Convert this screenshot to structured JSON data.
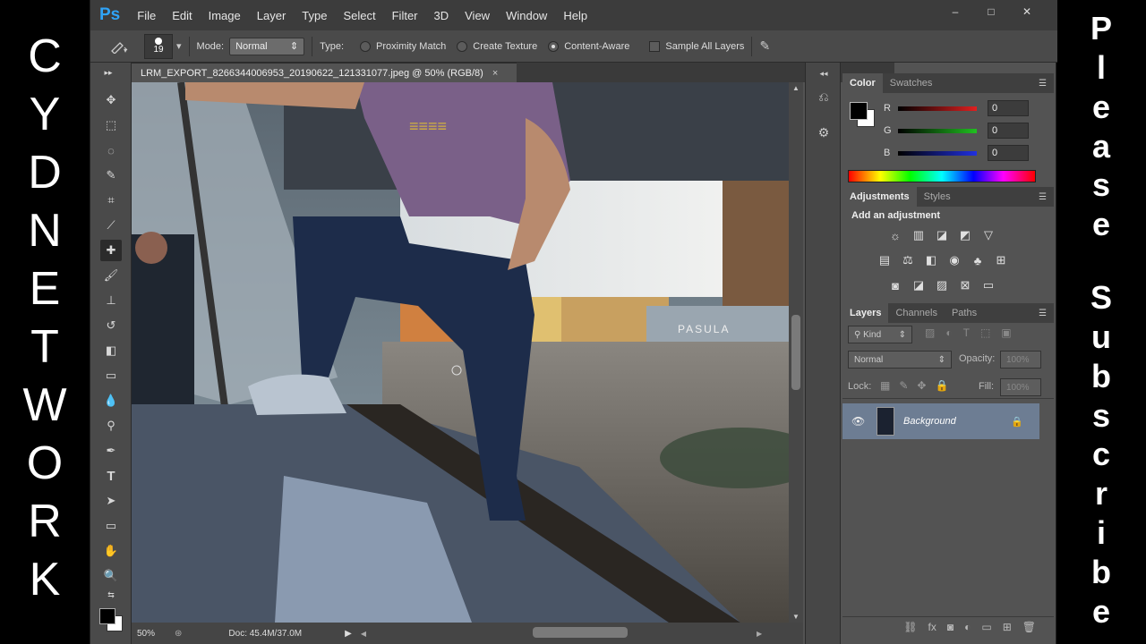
{
  "overlay": {
    "left_letters": [
      "C",
      "Y",
      "D",
      "N",
      "E",
      "T",
      "W",
      "O",
      "R",
      "K"
    ],
    "right_letters": [
      "P",
      "l",
      "e",
      "a",
      "s",
      "e",
      "",
      "S",
      "u",
      "b",
      "s",
      "c",
      "r",
      "i",
      "b",
      "e"
    ]
  },
  "app": {
    "logo": "Ps",
    "menu": [
      "File",
      "Edit",
      "Image",
      "Layer",
      "Type",
      "Select",
      "Filter",
      "3D",
      "View",
      "Window",
      "Help"
    ],
    "window_buttons": [
      "–",
      "□",
      "✕"
    ]
  },
  "options": {
    "brush_size": "19",
    "mode_label": "Mode:",
    "mode_value": "Normal",
    "type_label": "Type:",
    "types": [
      {
        "label": "Proximity Match",
        "selected": false
      },
      {
        "label": "Create Texture",
        "selected": false
      },
      {
        "label": "Content-Aware",
        "selected": true
      }
    ],
    "sample_all_layers": "Sample All Layers"
  },
  "document": {
    "tab_title": "LRM_EXPORT_8266344006953_20190622_121331077.jpeg @ 50% (RGB/8)",
    "tab_close": "×",
    "zoom": "50%",
    "doc_info": "Doc: 45.4M/37.0M",
    "storefront_sign": "PASULA"
  },
  "color_panel": {
    "tabs": [
      "Color",
      "Swatches"
    ],
    "channels": [
      {
        "name": "R",
        "value": "0",
        "color": "#e02020"
      },
      {
        "name": "G",
        "value": "0",
        "color": "#20b020"
      },
      {
        "name": "B",
        "value": "0",
        "color": "#2030d0"
      }
    ]
  },
  "adjustments_panel": {
    "tabs": [
      "Adjustments",
      "Styles"
    ],
    "heading": "Add an adjustment"
  },
  "layers_panel": {
    "tabs": [
      "Layers",
      "Channels",
      "Paths"
    ],
    "kind": "Kind",
    "blend_mode": "Normal",
    "opacity_label": "Opacity:",
    "opacity_value": "100%",
    "lock_label": "Lock:",
    "fill_label": "Fill:",
    "fill_value": "100%",
    "layers": [
      {
        "name": "Background",
        "visible": true,
        "locked": true
      }
    ]
  }
}
